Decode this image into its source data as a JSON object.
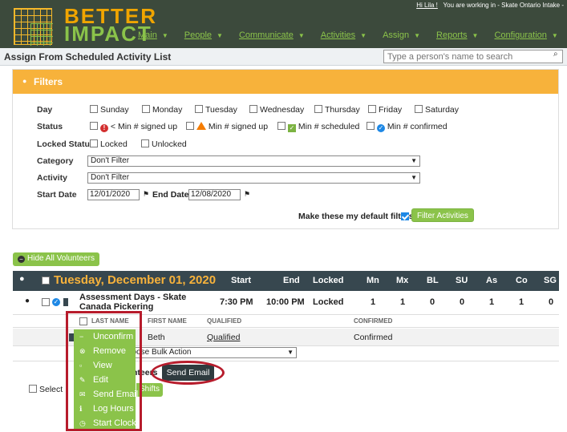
{
  "header": {
    "brand_top": "BETTER",
    "brand_bottom": "IMPACT",
    "user_name": "Hi Lila !",
    "working_in": "You are working in - Skate Ontario Intake -",
    "nav": [
      {
        "label": "Main"
      },
      {
        "label": "People"
      },
      {
        "label": "Communicate"
      },
      {
        "label": "Activities"
      },
      {
        "label": "Assign"
      },
      {
        "label": "Reports"
      },
      {
        "label": "Configuration"
      }
    ]
  },
  "page": {
    "title": "Assign From Scheduled Activity List",
    "search_placeholder": "Type a person's name to search"
  },
  "filters": {
    "title": "Filters",
    "day_label": "Day",
    "days": [
      "Sunday",
      "Monday",
      "Tuesday",
      "Wednesday",
      "Thursday",
      "Friday",
      "Saturday"
    ],
    "status_label": "Status",
    "status_opts": [
      "< Min # signed up",
      "Min # signed up",
      "Min # scheduled",
      "Min # confirmed"
    ],
    "locked_label": "Locked Status",
    "locked_opts": [
      "Locked",
      "Unlocked"
    ],
    "category_label": "Category",
    "category_value": "Don't Filter",
    "activity_label": "Activity",
    "activity_value": "Don't Filter",
    "start_label": "Start Date",
    "start_value": "12/01/2020",
    "end_label": "End Date",
    "end_value": "12/08/2020",
    "default_label": "Make these my default filters",
    "filter_button": "Filter Activities"
  },
  "hide_volunteers": "Hide All Volunteers",
  "day_table": {
    "date_title": "Tuesday, December 01, 2020",
    "columns": [
      "Start",
      "End",
      "Locked",
      "Mn",
      "Mx",
      "BL",
      "SU",
      "As",
      "Co",
      "SG"
    ],
    "shift": {
      "name": "Assessment Days - Skate Canada Pickering",
      "start": "7:30 PM",
      "end": "10:00 PM",
      "locked": "Locked",
      "mn": "1",
      "mx": "1",
      "bl": "0",
      "su": "0",
      "as": "1",
      "co": "1",
      "sg": "0"
    },
    "vol_columns": [
      "LAST NAME",
      "FIRST NAME",
      "QUALIFIED",
      "CONFIRMED"
    ],
    "volunteer": {
      "first_name": "Beth",
      "qualified": "Qualified",
      "confirmed": "Confirmed"
    },
    "bulk_action": "hoose Bulk Action",
    "volunteers_text": "nteers",
    "send_email": "Send Email",
    "select_all": "Select",
    "shifts": "Shifts"
  },
  "context_menu": {
    "items": [
      {
        "label": "Unconfirm",
        "icon": "minus-icon"
      },
      {
        "label": "Remove",
        "icon": "x-circle-icon"
      },
      {
        "label": "View",
        "icon": "doc-icon"
      },
      {
        "label": "Edit",
        "icon": "pencil-icon"
      },
      {
        "label": "Send Email",
        "icon": "envelope-icon"
      },
      {
        "label": "Log Hours",
        "icon": "info-icon"
      },
      {
        "label": "Start Clock",
        "icon": "clock-icon"
      }
    ]
  },
  "colors": {
    "header_bg": "#3c4a3c",
    "accent_orange": "#f7b23b",
    "accent_green": "#8bc34a",
    "highlight_red": "#b71c2c"
  }
}
